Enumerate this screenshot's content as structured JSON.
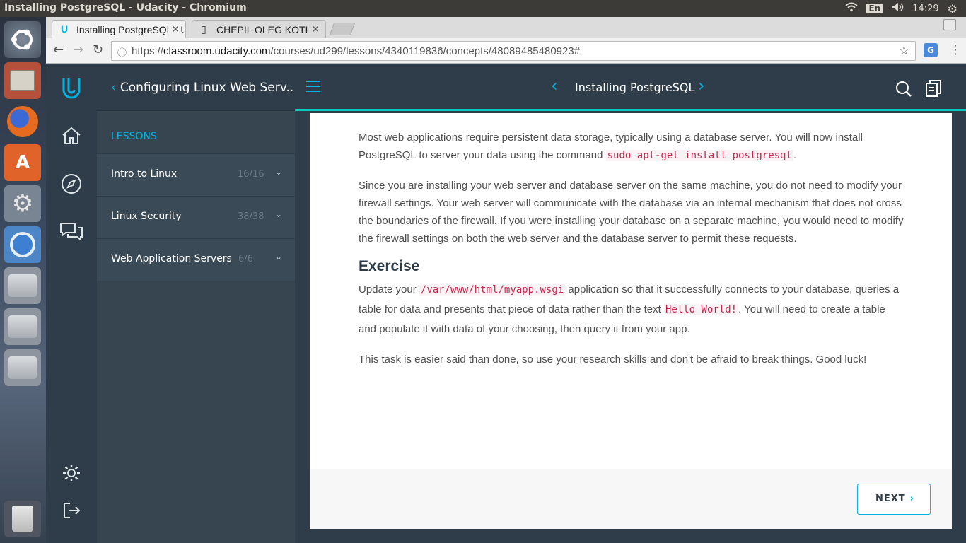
{
  "system": {
    "window_title": "Installing PostgreSQL - Udacity - Chromium",
    "keyboard_layout": "En",
    "clock": "14:29"
  },
  "launcher": {
    "icons": [
      "ubuntu-dash-icon",
      "files-icon",
      "firefox-icon",
      "software-center-icon",
      "system-settings-icon",
      "chromium-icon",
      "drive-icon",
      "drive-icon",
      "drive-icon",
      "trash-icon"
    ]
  },
  "browser": {
    "tabs": [
      {
        "label": "Installing PostgreSQL - Udacity",
        "icon": "udacity-icon"
      },
      {
        "label": "CHEPIL OLEG KOTI",
        "icon": "page-icon"
      }
    ],
    "url_prefix": "https://",
    "url_host": "classroom.udacity.com",
    "url_path": "/courses/ud299/lessons/4340119836/concepts/48089485480923#"
  },
  "sidebar": {
    "course_title": "Configuring Linux Web Serv...",
    "lessons_label": "LESSONS",
    "lessons": [
      {
        "title": "Intro to Linux",
        "progress": "16/16"
      },
      {
        "title": "Linux Security",
        "progress": "38/38"
      },
      {
        "title": "Web Application Servers",
        "progress": "6/6"
      }
    ]
  },
  "header": {
    "concept_title": "Installing PostgreSQL"
  },
  "article": {
    "p1_a": "Most web applications require persistent data storage, typically using a database server. You will now install PostgreSQL to server your data using the command ",
    "p1_code": "sudo apt-get install postgresql",
    "p1_b": ".",
    "p2": "Since you are installing your web server and database server on the same machine, you do not need to modify your firewall settings. Your web server will communicate with the database via an internal mechanism that does not cross the boundaries of the firewall. If you were installing your database on a separate machine, you would need to modify the firewall settings on both the web server and the database server to permit these requests.",
    "heading": "Exercise",
    "p3_a": "Update your ",
    "p3_code1": "/var/www/html/myapp.wsgi",
    "p3_b": " application so that it successfully connects to your database, queries a table for data and presents that piece of data rather than the text ",
    "p3_code2": "Hello World!",
    "p3_c": ". You will need to create a table and populate it with data of your choosing, then query it from your app.",
    "p4": "This task is easier said than done, so use your research skills and don't be afraid to break things. Good luck!"
  },
  "footer": {
    "next_label": "NEXT"
  },
  "colors": {
    "accent": "#02b3e4",
    "teal_line": "#02ccba",
    "navy": "#2e3d49",
    "code_red": "#c7254e"
  }
}
